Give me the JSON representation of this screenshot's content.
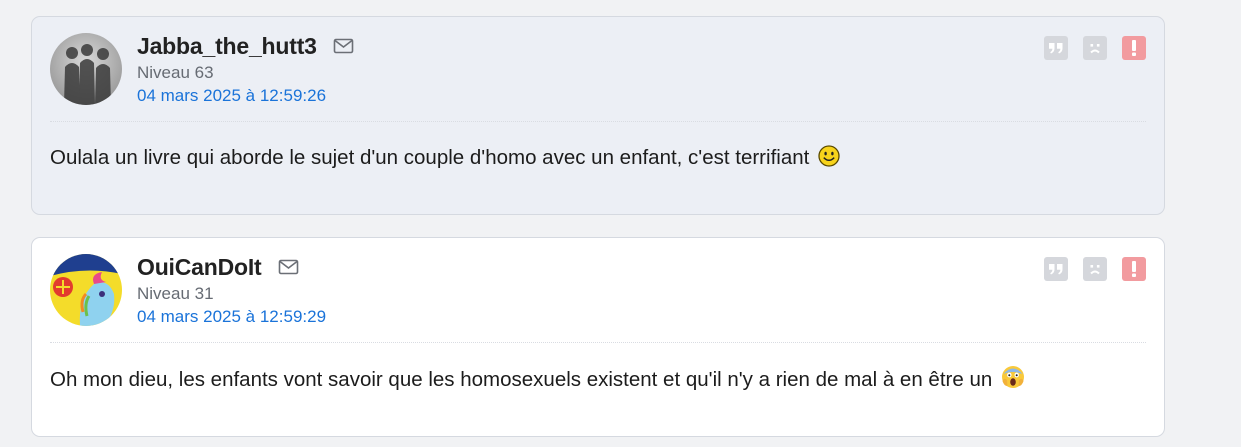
{
  "posts": [
    {
      "username": "Jabba_the_hutt3",
      "level": "Niveau 63",
      "date": "04 mars 2025 à 12:59:26",
      "message": "Oulala un livre qui aborde le sujet d'un couple d'homo avec un enfant, c'est terrifiant",
      "emoji": "smiley-icon"
    },
    {
      "username": "OuiCanDoIt",
      "level": "Niveau 31",
      "date": "04 mars 2025 à 12:59:29",
      "message": "Oh mon dieu, les enfants vont savoir que les homosexuels existent et qu'il n'y a rien de mal à en être un",
      "emoji": "screaming-face-icon"
    }
  ],
  "icons": {
    "message": "mail-icon",
    "quote": "quote-icon",
    "report_sad": "sad-face-icon",
    "alert": "exclamation-icon"
  },
  "colors": {
    "date_link": "#1a73d9",
    "alert_button": "#f29b9f",
    "action_button": "#d5d7dc",
    "post_bg_alt": "#eceff5"
  }
}
